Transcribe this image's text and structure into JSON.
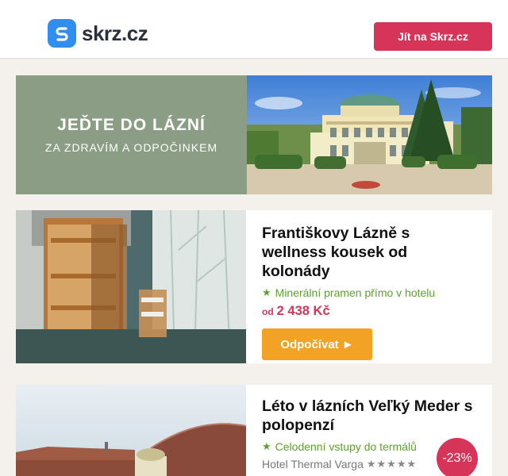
{
  "header": {
    "logo_text": "skrz.cz",
    "cta_label": "Jít na Skrz.cz"
  },
  "banner": {
    "title": "JEĎTE DO LÁZNÍ",
    "subtitle": "ZA ZDRAVÍM A ODPOČINKEM"
  },
  "offers": [
    {
      "title": "Františkovy Lázně s wellness kousek od kolonády",
      "feature": "Minerální pramen přímo v hotelu",
      "price_prefix": "od",
      "price": "2 438 Kč",
      "button_label": "Odpočívat ►"
    },
    {
      "title": "Léto v lázních Veľký Meder s polopenzí",
      "feature": "Celodenní vstupy do termálů",
      "hotel": "Hotel Thermal Varga",
      "stars": "★★★★★",
      "discount": "-23%"
    }
  ],
  "colors": {
    "brand_blue": "#2f8ef0",
    "accent_red": "#d7345a",
    "feature_green": "#5ea22d",
    "button_orange": "#f2a224",
    "banner_green": "#8c9d86"
  }
}
